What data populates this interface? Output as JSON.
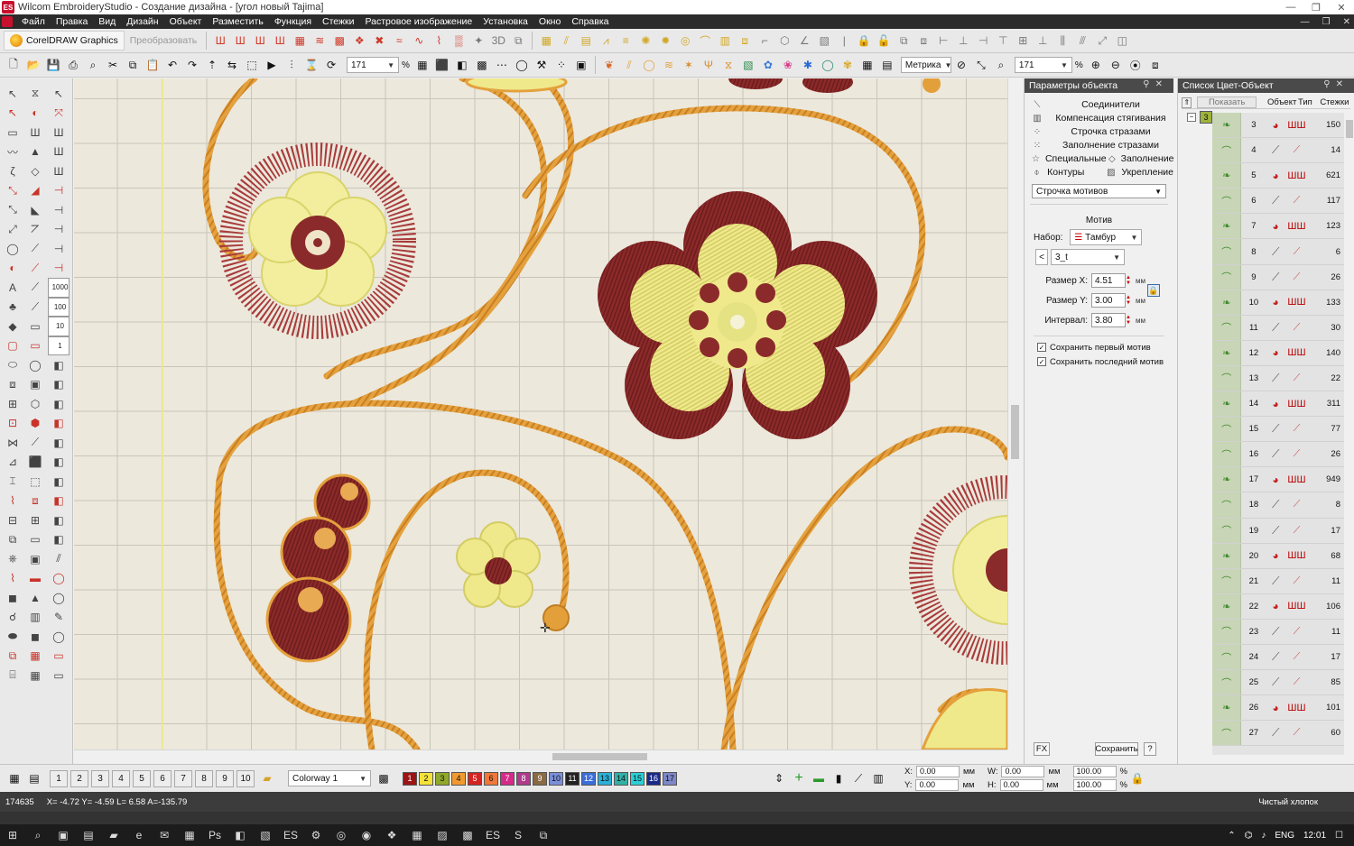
{
  "window": {
    "title": "Wilcom EmbroideryStudio - Создание дизайна - [угол новый      Tajima]",
    "logo": "ES"
  },
  "menu": [
    "Файл",
    "Правка",
    "Вид",
    "Дизайн",
    "Объект",
    "Разместить",
    "Функция",
    "Стежки",
    "Растровое изображение",
    "Установка",
    "Окно",
    "Справка"
  ],
  "toolbar1": {
    "coreldraw_label": "CorelDRAW Graphics",
    "transform_label": "Преобразовать"
  },
  "toolbar2": {
    "zoom_value": "171",
    "zoom_unit": "%",
    "units_value": "Метрика",
    "zoom_value2": "171",
    "zoom_unit2": "%"
  },
  "left_tool_numbers": [
    "1000",
    "100",
    "10",
    "1"
  ],
  "props_panel": {
    "title": "Параметры объекта",
    "items": [
      "Соединители",
      "Компенсация стягивания",
      "Строчка стразами",
      "Заполнение стразами"
    ],
    "pair1": [
      "Специальные",
      "Заполнение"
    ],
    "pair2": [
      "Контуры",
      "Укрепление"
    ],
    "stitch_type": "Строчка мотивов",
    "motif_group_label": "Мотив",
    "set_label": "Набор:",
    "set_value": "Тамбур",
    "motif_value": "3_t",
    "size_x_label": "Размер X:",
    "size_x": "4.51",
    "size_y_label": "Размер Y:",
    "size_y": "3.00",
    "interval_label": "Интервал:",
    "interval": "3.80",
    "unit": "мм",
    "keep_first": "Сохранить первый мотив",
    "keep_last": "Сохранить последний мотив",
    "fx_label": "FX",
    "save_label": "Сохранить",
    "help_label": "?"
  },
  "color_list": {
    "title": "Список Цвет-Объект",
    "show_label": "Показать",
    "columns": [
      "Объект",
      "Тип",
      "Стежки"
    ],
    "group_number": "3",
    "rows": [
      {
        "n": "3",
        "type": "sat",
        "stitches": "150"
      },
      {
        "n": "4",
        "type": "run",
        "stitches": "14"
      },
      {
        "n": "5",
        "type": "sat",
        "stitches": "621"
      },
      {
        "n": "6",
        "type": "run",
        "stitches": "117"
      },
      {
        "n": "7",
        "type": "sat",
        "stitches": "123"
      },
      {
        "n": "8",
        "type": "run",
        "stitches": "6"
      },
      {
        "n": "9",
        "type": "run",
        "stitches": "26"
      },
      {
        "n": "10",
        "type": "sat",
        "stitches": "133"
      },
      {
        "n": "11",
        "type": "run",
        "stitches": "30"
      },
      {
        "n": "12",
        "type": "sat",
        "stitches": "140"
      },
      {
        "n": "13",
        "type": "run",
        "stitches": "22"
      },
      {
        "n": "14",
        "type": "sat",
        "stitches": "311"
      },
      {
        "n": "15",
        "type": "run",
        "stitches": "77"
      },
      {
        "n": "16",
        "type": "run",
        "stitches": "26"
      },
      {
        "n": "17",
        "type": "sat",
        "stitches": "949"
      },
      {
        "n": "18",
        "type": "run",
        "stitches": "8"
      },
      {
        "n": "19",
        "type": "run",
        "stitches": "17"
      },
      {
        "n": "20",
        "type": "sat",
        "stitches": "68"
      },
      {
        "n": "21",
        "type": "run",
        "stitches": "11"
      },
      {
        "n": "22",
        "type": "sat",
        "stitches": "106"
      },
      {
        "n": "23",
        "type": "run",
        "stitches": "11"
      },
      {
        "n": "24",
        "type": "run",
        "stitches": "17"
      },
      {
        "n": "25",
        "type": "run",
        "stitches": "85"
      },
      {
        "n": "26",
        "type": "sat",
        "stitches": "101"
      },
      {
        "n": "27",
        "type": "run",
        "stitches": "60"
      }
    ]
  },
  "bottom": {
    "hoop_tabs": [
      "1",
      "2",
      "3",
      "4",
      "5",
      "6",
      "7",
      "8",
      "9",
      "10"
    ],
    "colorway": "Colorway 1",
    "swatches": [
      {
        "n": "1",
        "c": "#9c1414"
      },
      {
        "n": "2",
        "c": "#f2e23a"
      },
      {
        "n": "3",
        "c": "#8fa829"
      },
      {
        "n": "4",
        "c": "#f29a2e"
      },
      {
        "n": "5",
        "c": "#d42323"
      },
      {
        "n": "6",
        "c": "#f07838"
      },
      {
        "n": "7",
        "c": "#d62a88"
      },
      {
        "n": "8",
        "c": "#b03a8c"
      },
      {
        "n": "9",
        "c": "#8a6a44"
      },
      {
        "n": "10",
        "c": "#7a8fd8"
      },
      {
        "n": "11",
        "c": "#222222"
      },
      {
        "n": "12",
        "c": "#3a6ed8"
      },
      {
        "n": "13",
        "c": "#2ab0d8"
      },
      {
        "n": "14",
        "c": "#33b0a8"
      },
      {
        "n": "15",
        "c": "#2ad0d8"
      },
      {
        "n": "16",
        "c": "#1a2a8a"
      },
      {
        "n": "17",
        "c": "#7c88c8"
      }
    ],
    "x_label": "X:",
    "x_value": "0.00",
    "y_label": "Y:",
    "y_value": "0.00",
    "w_label": "W:",
    "w_value": "0.00",
    "h_label": "H:",
    "h_value": "0.00",
    "unit": "мм",
    "scale_w": "100.00",
    "scale_h": "100.00",
    "pct": "%"
  },
  "status": {
    "stitch_count": "174635",
    "coords": "X=  -4.72 Y=  -4.59 L=  6.58 A=-135.79",
    "fabric": "Чистый хлопок"
  },
  "taskbar": {
    "lang": "ENG",
    "time": "12:01"
  },
  "colors": {
    "thread_red": "#8b2a2a",
    "thread_gold": "#e4a13d",
    "thread_yellow": "#efe98c",
    "canvas_bg": "#ece8dc"
  }
}
